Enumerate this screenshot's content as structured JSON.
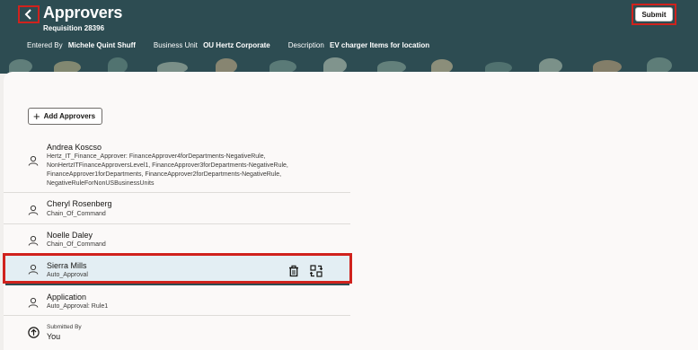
{
  "header": {
    "title": "Approvers",
    "subtitle": "Requisition 28396",
    "entered_by_label": "Entered By",
    "entered_by_value": "Michele Quint Shuff",
    "business_unit_label": "Business Unit",
    "business_unit_value": "OU Hertz Corporate",
    "description_label": "Description",
    "description_value": "EV charger Items for location",
    "submit_label": "Submit",
    "colors": {
      "bar": "#2d4c52",
      "highlight": "#d0221d"
    }
  },
  "actions": {
    "add_approvers_label": "Add Approvers"
  },
  "approvers": [
    {
      "name": "Andrea Koscso",
      "rule_name": "Hertz_IT_Finance_Approver",
      "rule_lines": [
        "Hertz_IT_Finance_Approver: FinanceApprover4forDepartments-NegativeRule,",
        "NonHertzITFinanceApproversLevel1, FinanceApprover3forDepartments-NegativeRule,",
        "FinanceApprover1forDepartments, FinanceApprover2forDepartments-NegativeRule,",
        "NegativeRuleForNonUSBusinessUnits"
      ]
    },
    {
      "name": "Cheryl Rosenberg",
      "rule_lines": [
        "Chain_Of_Command"
      ]
    },
    {
      "name": "Noelle Daley",
      "rule_lines": [
        "Chain_Of_Command"
      ]
    },
    {
      "name": "Sierra Mills",
      "rule_lines": [
        "Auto_Approval"
      ],
      "selected": true
    },
    {
      "name": "Application",
      "rule_lines": [
        "Auto_Approval: Rule1"
      ]
    }
  ],
  "submitted": {
    "label": "Submitted By",
    "value": "You"
  },
  "icons": [
    "back-icon",
    "plus-icon",
    "person-icon",
    "delete-icon",
    "reassign-icon",
    "submitted-icon"
  ]
}
